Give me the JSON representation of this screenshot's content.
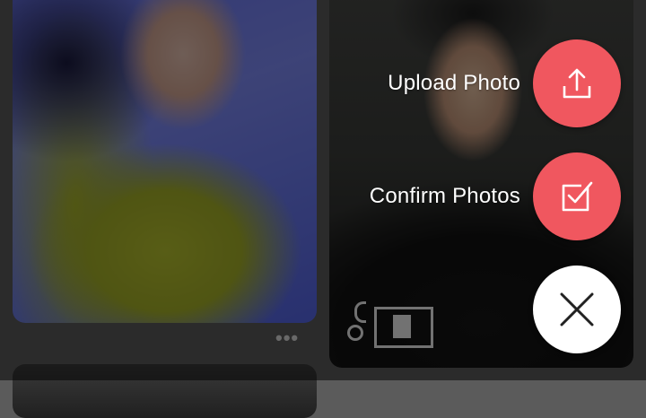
{
  "menu": {
    "upload_label": "Upload Photo",
    "confirm_label": "Confirm Photos"
  },
  "icons": {
    "upload": "upload-icon",
    "confirm": "checkbox-icon",
    "close": "close-icon",
    "more": "more-dots-icon"
  },
  "colors": {
    "accent": "#f0575f",
    "close_button": "#ffffff",
    "overlay": "rgba(0,0,0,0.52)"
  },
  "grid": {
    "more_glyph": "•••"
  }
}
